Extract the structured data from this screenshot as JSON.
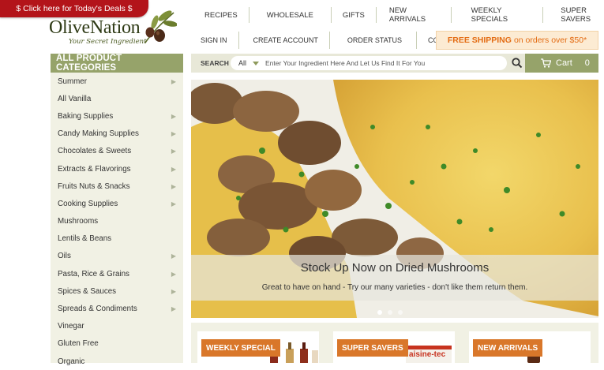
{
  "deals": {
    "label": "$ Click here for Today's Deals $"
  },
  "logo": {
    "name": "OliveNation",
    "tagline": "Your Secret Ingredient"
  },
  "nav_primary": [
    "RECIPES",
    "WHOLESALE",
    "GIFTS",
    "NEW ARRIVALS",
    "WEEKLY SPECIALS",
    "SUPER SAVERS"
  ],
  "nav_secondary": [
    "SIGN IN",
    "CREATE ACCOUNT",
    "ORDER STATUS",
    "CONTACT US"
  ],
  "shipping": {
    "bold": "FREE SHIPPING",
    "rest": "on orders over $50*"
  },
  "sidebar": {
    "title": "ALL PRODUCT CATEGORIES",
    "items": [
      {
        "label": "Summer",
        "has_arrow": true
      },
      {
        "label": "All Vanilla",
        "has_arrow": false
      },
      {
        "label": "Baking Supplies",
        "has_arrow": true
      },
      {
        "label": "Candy Making Supplies",
        "has_arrow": true
      },
      {
        "label": "Chocolates & Sweets",
        "has_arrow": true
      },
      {
        "label": "Extracts & Flavorings",
        "has_arrow": true
      },
      {
        "label": "Fruits Nuts & Snacks",
        "has_arrow": true
      },
      {
        "label": "Cooking Supplies",
        "has_arrow": true
      },
      {
        "label": "Mushrooms",
        "has_arrow": false
      },
      {
        "label": "Lentils & Beans",
        "has_arrow": false
      },
      {
        "label": "Oils",
        "has_arrow": true
      },
      {
        "label": "Pasta, Rice & Grains",
        "has_arrow": true
      },
      {
        "label": "Spices & Sauces",
        "has_arrow": true
      },
      {
        "label": "Spreads & Condiments",
        "has_arrow": true
      },
      {
        "label": "Vinegar",
        "has_arrow": false
      },
      {
        "label": "Gluten Free",
        "has_arrow": false
      },
      {
        "label": "Organic",
        "has_arrow": false
      }
    ]
  },
  "search": {
    "label": "SEARCH",
    "scope": "All",
    "placeholder": "Enter Your Ingredient Here And Let Us Find It For You"
  },
  "cart": {
    "label": "Cart",
    "count": "0"
  },
  "hero": {
    "title": "Stock Up Now on Dried Mushrooms",
    "subtitle": "Great to have on hand - Try our many varieties - don't like them return them.",
    "slide_count": 3,
    "active_slide": 1
  },
  "promos": [
    {
      "label": "WEEKLY SPECIAL"
    },
    {
      "label": "SUPER SAVERS",
      "product_text": "aisine-tec"
    },
    {
      "label": "NEW ARRIVALS"
    }
  ],
  "icons": {
    "deals_currency": "dollar-sign",
    "cart": "cart-icon",
    "search": "search-icon",
    "logo": "olive-branch-icon"
  },
  "colors": {
    "deals_red": "#b3141a",
    "olive_green": "#96a36a",
    "shipping_orange": "#e36c13",
    "promo_orange": "#d9772a",
    "sidebar_bg": "#f1f1e4"
  }
}
